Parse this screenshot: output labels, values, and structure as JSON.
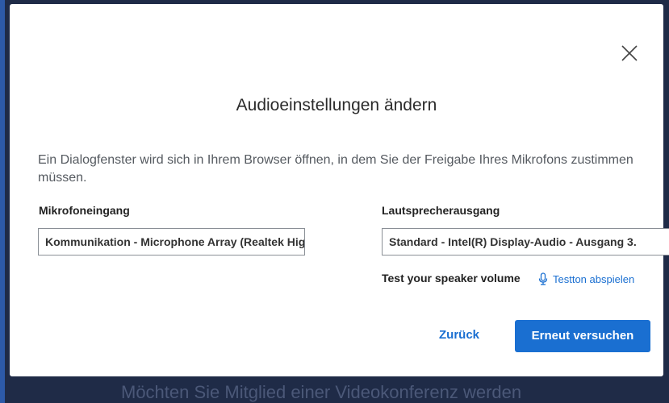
{
  "dialog": {
    "title": "Audioeinstellungen ändern",
    "description": "Ein Dialogfenster wird sich in Ihrem Browser öffnen, in dem Sie der Freigabe Ihres Mikrofons zustimmen müssen.",
    "close_icon": "close-icon"
  },
  "microphone": {
    "label": "Mikrofoneingang",
    "value": "Kommunikation - Microphone Array (Realtek High Definition Audio)"
  },
  "speaker": {
    "label": "Lautsprecherausgang",
    "value": "Standard - Intel(R) Display-Audio - Ausgang 3."
  },
  "speaker_test": {
    "label": "Test your speaker volume",
    "link_label": "Testton abspielen",
    "link_icon": "microphone-icon"
  },
  "actions": {
    "back_label": "Zurück",
    "retry_label": "Erneut versuchen"
  },
  "background": {
    "text": "Möchten Sie Mitglied einer Videokonferenz werden"
  },
  "colors": {
    "accent": "#1a6fd1",
    "backdrop": "#1f2b47"
  }
}
